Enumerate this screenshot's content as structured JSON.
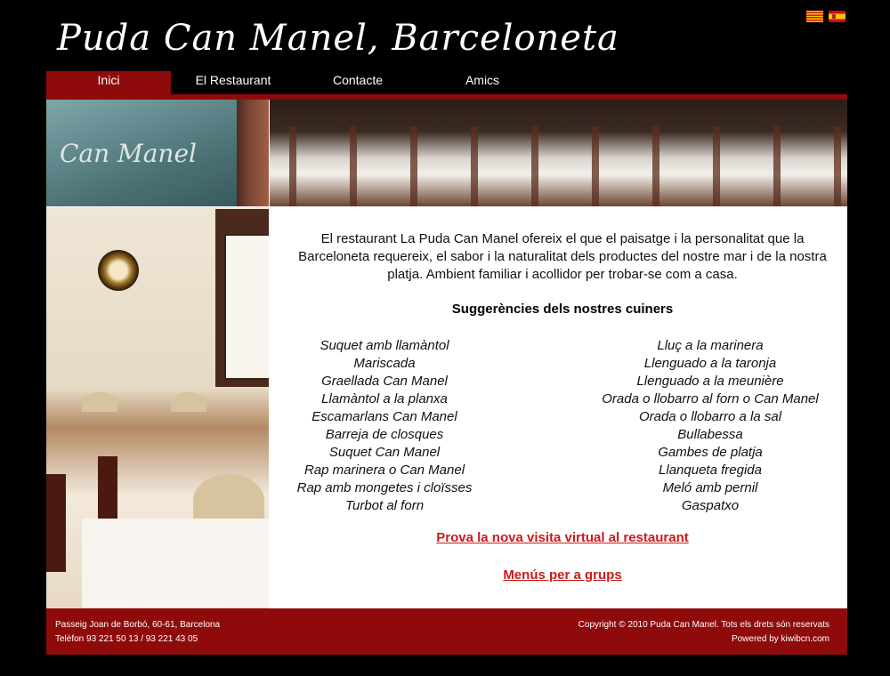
{
  "header": {
    "title": "Puda Can Manel, Barceloneta"
  },
  "flags": [
    {
      "icon": "catalan-flag-icon"
    },
    {
      "icon": "spanish-flag-icon"
    }
  ],
  "nav": {
    "tabs": [
      {
        "label": "Inici",
        "active": true
      },
      {
        "label": "El Restaurant",
        "active": false
      },
      {
        "label": "Contacte",
        "active": false
      },
      {
        "label": "Amics",
        "active": false
      }
    ]
  },
  "images": {
    "sign_text": "Can Manel"
  },
  "main": {
    "intro": "El restaurant La Puda Can Manel ofereix el que el paisatge i la personalitat que la Barceloneta requereix, el sabor i la naturalitat dels productes del nostre mar i de la nostra platja. Ambient familiar i acollidor per trobar-se com a casa.",
    "suggestions_title": "Suggerències dels nostres cuiners",
    "dishes_left": [
      "Suquet amb llamàntol",
      "Mariscada",
      "Graellada Can Manel",
      "Llamàntol a la planxa",
      "Escamarlans Can Manel",
      "Barreja de closques",
      "Suquet Can Manel",
      "Rap marinera o Can Manel",
      "Rap amb mongetes i cloïsses",
      "Turbot al forn"
    ],
    "dishes_right": [
      "Lluç a la marinera",
      "Llenguado a la taronja",
      "Llenguado a la meunière",
      "Orada o llobarro al forn o Can Manel",
      "Orada o llobarro a la sal",
      "Bullabessa",
      "Gambes de platja",
      "Llanqueta fregida",
      "Meló amb pernil",
      "Gaspatxo"
    ],
    "virtual_tour_link": "Prova la nova visita virtual al restaurant",
    "group_menus_link": "Menús per a grups"
  },
  "footer": {
    "address": "Passeig Joan de Borbó, 60-61, Barcelona",
    "phone": "Telèfon 93 221 50 13 / 93 221 43 05",
    "copyright": "Copyright © 2010 Puda Can Manel. Tots els drets són reservats",
    "powered_by": "Powered by kiwibcn.com"
  },
  "colors": {
    "accent": "#8f0b0b",
    "link": "#cc1b1b",
    "background": "#000000"
  }
}
